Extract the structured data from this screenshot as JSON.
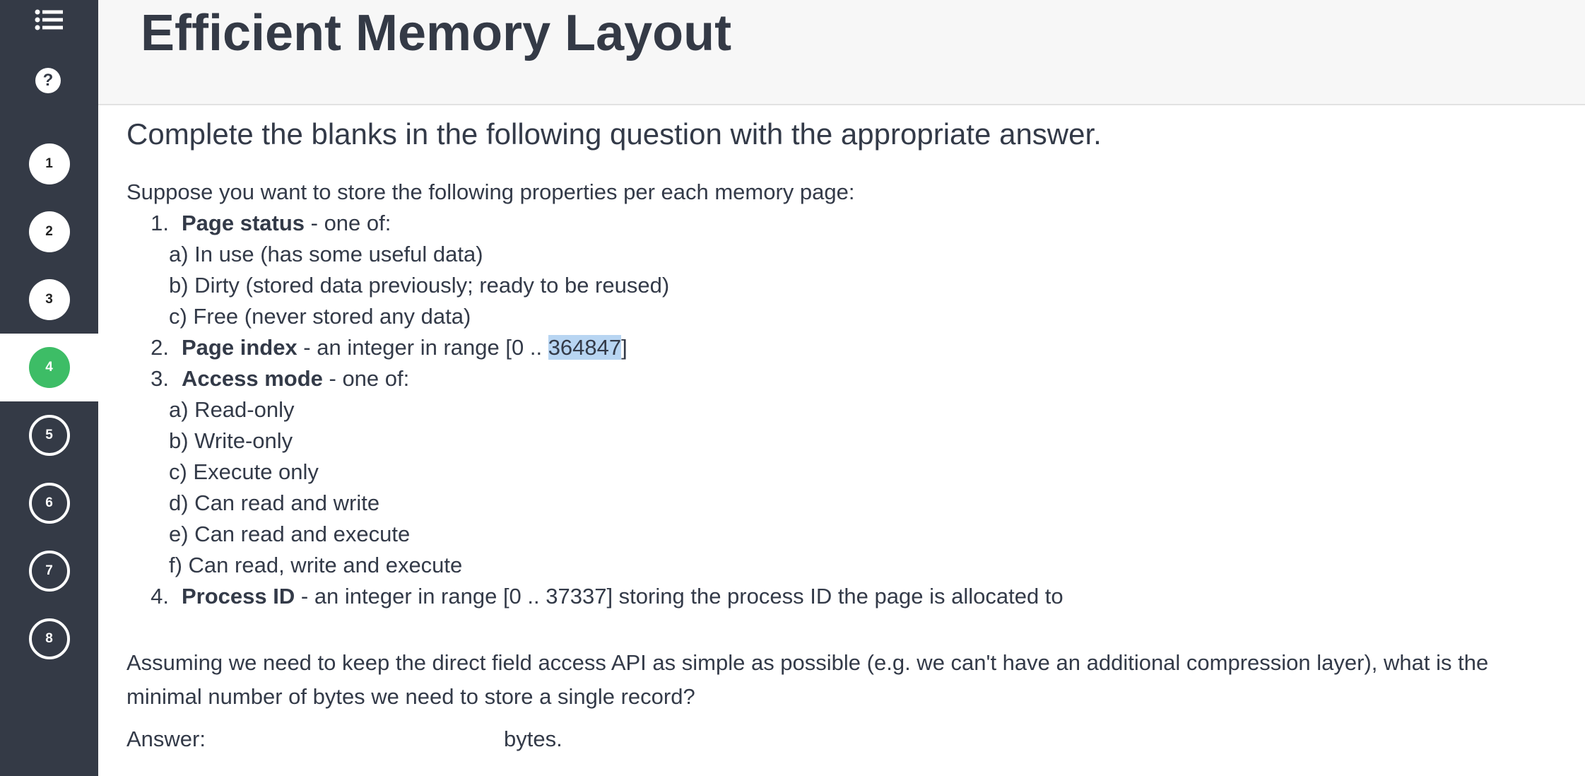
{
  "page": {
    "title": "Efficient Memory Layout"
  },
  "sidebar": {
    "menu_icon": "list-icon",
    "help_icon": "question-circle-icon",
    "help_glyph": "?",
    "steps": [
      {
        "label": "1",
        "state": "done"
      },
      {
        "label": "2",
        "state": "done"
      },
      {
        "label": "3",
        "state": "done"
      },
      {
        "label": "4",
        "state": "active"
      },
      {
        "label": "5",
        "state": "todo"
      },
      {
        "label": "6",
        "state": "todo"
      },
      {
        "label": "7",
        "state": "todo"
      },
      {
        "label": "8",
        "state": "todo"
      }
    ],
    "active_color": "#3dbd66",
    "background_color": "#343a46"
  },
  "question": {
    "instruction": "Complete the blanks in the following question with the appropriate answer.",
    "intro": "Suppose you want to store the following properties per each memory page:",
    "properties": [
      {
        "num": "1.",
        "name": "Page status",
        "desc": " - one of:",
        "options": [
          "a) In use (has some useful data)",
          "b) Dirty (stored data previously; ready to be reused)",
          "c) Free (never stored any data)"
        ]
      },
      {
        "num": "2.",
        "name": "Page index",
        "desc_before": " - an integer in range [0 .. ",
        "highlighted": "364847",
        "desc_after": "]"
      },
      {
        "num": "3.",
        "name": "Access mode",
        "desc": " - one of:",
        "options": [
          "a) Read-only",
          "b) Write-only",
          "c) Execute only",
          "d) Can read and write",
          "e) Can read and execute",
          "f) Can read, write and execute"
        ]
      },
      {
        "num": "4.",
        "name": "Process ID",
        "desc": " - an integer in range [0 .. 37337] storing the process ID the page is allocated to"
      }
    ],
    "prompt": "Assuming we need to keep the direct field access API as simple as possible (e.g. we can't have an additional compression layer), what is the minimal number of bytes we need to store a single record?",
    "answer_label": "Answer:",
    "answer_value": "",
    "answer_unit": "bytes."
  }
}
